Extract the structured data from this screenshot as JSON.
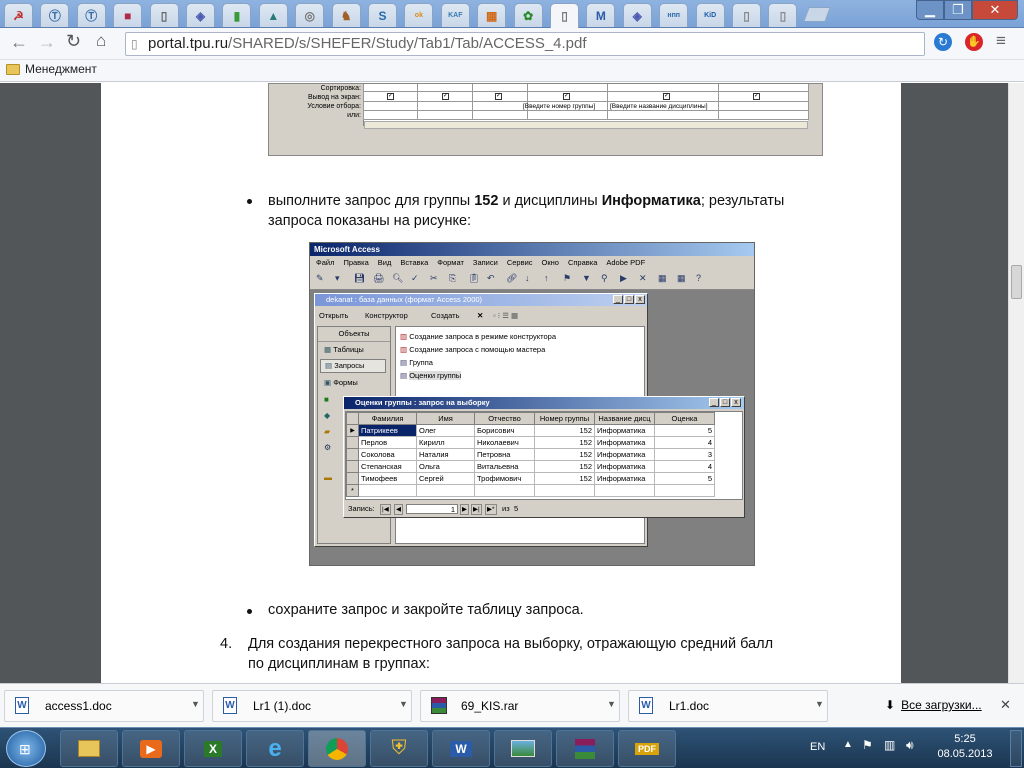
{
  "browser": {
    "tab_favicons": [
      "☭",
      "Ⓣ",
      "Ⓣ",
      "■",
      "▯",
      "◈",
      "▮",
      "▲",
      "◎",
      "♞",
      "S",
      "ok",
      "KAF",
      "▦",
      "✿",
      "▯",
      "M",
      "◈",
      "нпп",
      "KiD",
      "▯",
      "▯"
    ],
    "url_host": "portal.tpu.ru",
    "url_path": "/SHARED/s/SHEFER/Study/Tab1/Tab/ACCESS_4.pdf",
    "bookmark_folder": "Менеджмент"
  },
  "doc": {
    "design_grid": {
      "row_labels": [
        "Сортировка:",
        "Вывод на экран:",
        "Условие отбора:",
        "или:"
      ],
      "criteria_group": "[Введите номер группы]",
      "criteria_discipline": "[Введите название дисциплины]"
    },
    "bullet1_pre": "выполните запрос для группы ",
    "bullet1_bold1": "152",
    "bullet1_mid": " и дисциплины ",
    "bullet1_bold2": "Информатика",
    "bullet1_post": "; результаты",
    "bullet1_line2": "запроса показаны на рисунке:",
    "bullet2": "сохраните запрос и закройте таблицу запроса.",
    "item4_number": "4.",
    "item4_line1": "Для создания перекрестного запроса на выборку, отражающую средний балл",
    "item4_line2": "по дисциплинам в группах:"
  },
  "access": {
    "app_title": "Microsoft Access",
    "menu": [
      "Файл",
      "Правка",
      "Вид",
      "Вставка",
      "Формат",
      "Записи",
      "Сервис",
      "Окно",
      "Справка",
      "Adobe PDF"
    ],
    "db_title": "dekanat : база данных (формат Access 2000)",
    "db_toolbar": {
      "open": "Открыть",
      "design": "Конструктор",
      "create": "Создать"
    },
    "objects_header": "Объекты",
    "objects": [
      "Таблицы",
      "Запросы",
      "Формы"
    ],
    "query_items": [
      "Создание запроса в режиме конструктора",
      "Создание запроса с помощью мастера",
      "Группа",
      "Оценки группы"
    ],
    "result_title": "Оценки группы : запрос на выборку",
    "columns": [
      "Фамилия",
      "Имя",
      "Отчество",
      "Номер группы",
      "Название дисц",
      "Оценка"
    ],
    "rows": [
      [
        "Патрикеев",
        "Олег",
        "Борисович",
        "152",
        "Информатика",
        "5"
      ],
      [
        "Перлов",
        "Кирилл",
        "Николаевич",
        "152",
        "Информатика",
        "4"
      ],
      [
        "Соколова",
        "Наталия",
        "Петровна",
        "152",
        "Информатика",
        "3"
      ],
      [
        "Степанская",
        "Ольга",
        "Витальевна",
        "152",
        "Информатика",
        "4"
      ],
      [
        "Тимофеев",
        "Сергей",
        "Трофимович",
        "152",
        "Информатика",
        "5"
      ]
    ],
    "nav_label": "Запись:",
    "nav_current": "1",
    "nav_of": "из",
    "nav_total": "5"
  },
  "downloads": {
    "files": [
      "access1.doc",
      "Lr1 (1).doc",
      "69_KIS.rar",
      "Lr1.doc"
    ],
    "all_downloads": "Все загрузки..."
  },
  "taskbar": {
    "lang": "EN",
    "time": "5:25",
    "date": "08.05.2013"
  }
}
